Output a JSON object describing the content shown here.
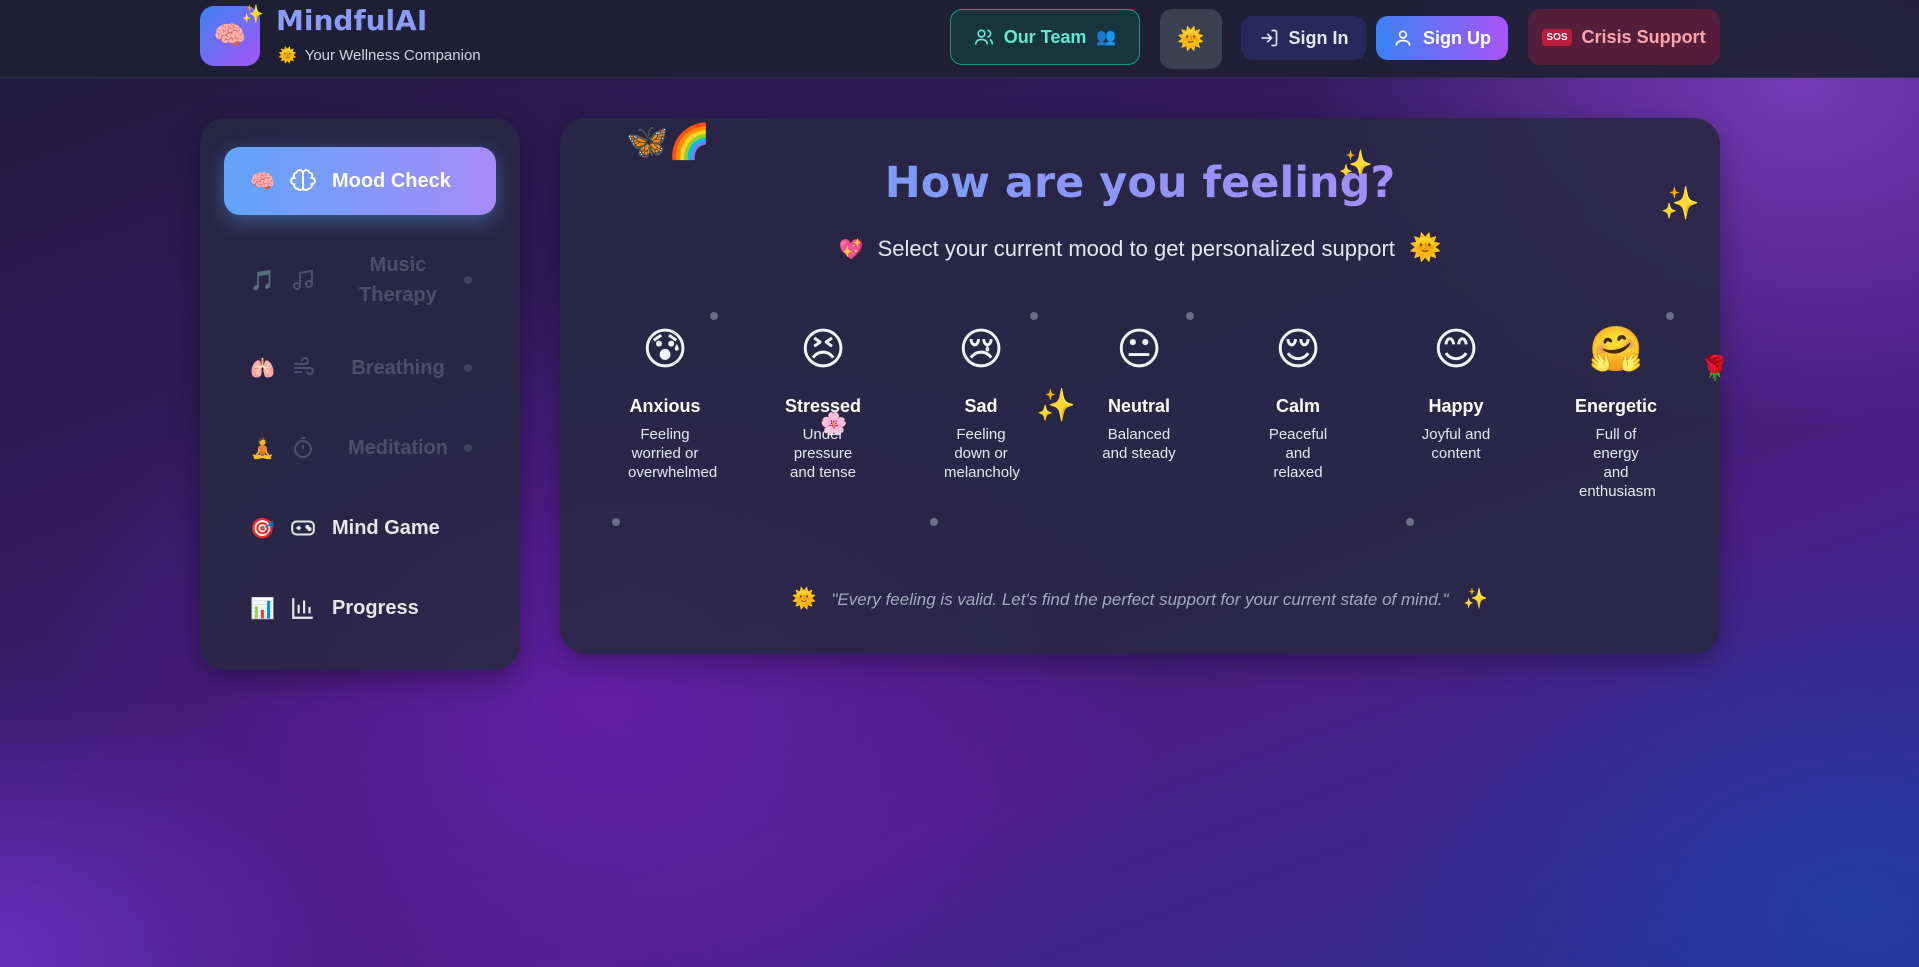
{
  "header": {
    "brand_title": "MindfulAI",
    "brand_subtitle": "Your Wellness Companion",
    "team_label": "Our Team",
    "signin_label": "Sign In",
    "signup_label": "Sign Up",
    "crisis_label": "Crisis Support",
    "sos_text": "SOS"
  },
  "sidebar": {
    "items": [
      {
        "label": "Mood Check",
        "emoji": "🧠"
      },
      {
        "label": "Music Therapy",
        "emoji": "🎵"
      },
      {
        "label": "Breathing",
        "emoji": "🫁"
      },
      {
        "label": "Meditation",
        "emoji": "🧘"
      },
      {
        "label": "Mind Game",
        "emoji": "🎯"
      },
      {
        "label": "Progress",
        "emoji": "📊"
      }
    ]
  },
  "main": {
    "title": "How are you feeling?",
    "subtitle": "Select your current mood to get personalized support",
    "moods": [
      {
        "emoji": "😰",
        "name": "Anxious",
        "desc": "Feeling worried or overwhelmed"
      },
      {
        "emoji": "😣",
        "name": "Stressed",
        "desc": "Under pressure and tense"
      },
      {
        "emoji": "😢",
        "name": "Sad",
        "desc": "Feeling down or melancholy"
      },
      {
        "emoji": "😐",
        "name": "Neutral",
        "desc": "Balanced and steady"
      },
      {
        "emoji": "😌",
        "name": "Calm",
        "desc": "Peaceful and relaxed"
      },
      {
        "emoji": "😊",
        "name": "Happy",
        "desc": "Joyful and content"
      },
      {
        "emoji": "🤗",
        "name": "Energetic",
        "desc": "Full of energy and enthusiasm"
      }
    ],
    "quote": "\"Every feeling is valid. Let's find the perfect support for your current state of mind.\""
  }
}
